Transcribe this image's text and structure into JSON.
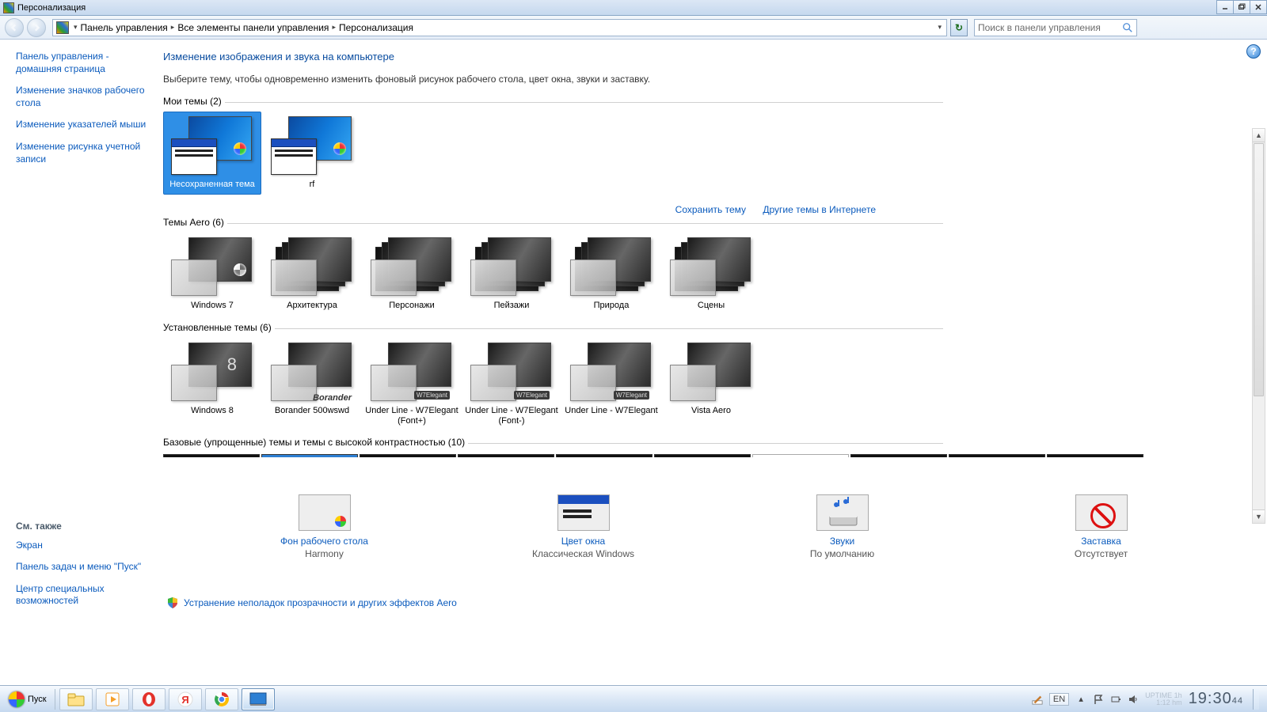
{
  "window": {
    "title": "Персонализация"
  },
  "win_btns": {
    "min": "_",
    "max": "❐",
    "close": "✕"
  },
  "breadcrumb": {
    "segments": [
      "Панель управления",
      "Все элементы панели управления",
      "Персонализация"
    ]
  },
  "search": {
    "placeholder": "Поиск в панели управления"
  },
  "help_btn": "?",
  "sidebar": {
    "links": [
      "Панель управления - домашняя страница",
      "Изменение значков рабочего стола",
      "Изменение указателей мыши",
      "Изменение рисунка учетной записи"
    ]
  },
  "see_also": {
    "heading": "См. также",
    "links": [
      "Экран",
      "Панель задач и меню \"Пуск\"",
      "Центр специальных возможностей"
    ]
  },
  "page": {
    "heading": "Изменение изображения и звука на компьютере",
    "desc": "Выберите тему, чтобы одновременно изменить фоновый рисунок рабочего стола, цвет окна, звуки и заставку."
  },
  "groups": {
    "my": {
      "title": "Мои темы (2)",
      "items": [
        {
          "label": "Несохраненная тема",
          "selected": true
        },
        {
          "label": "rf"
        }
      ],
      "links": {
        "save": "Сохранить тему",
        "more": "Другие темы в Интернете"
      }
    },
    "aero": {
      "title": "Темы Aero (6)",
      "items": [
        {
          "label": "Windows 7"
        },
        {
          "label": "Архитектура"
        },
        {
          "label": "Персонажи"
        },
        {
          "label": "Пейзажи"
        },
        {
          "label": "Природа"
        },
        {
          "label": "Сцены"
        }
      ]
    },
    "installed": {
      "title": "Установленные темы (6)",
      "items": [
        {
          "label": "Windows 8"
        },
        {
          "label": "Borander 500wswd",
          "overlay": "Borander"
        },
        {
          "label": "Under Line - W7Elegant (Font+)",
          "badge": "W7Elegant"
        },
        {
          "label": "Under Line - W7Elegant (Font-)",
          "badge": "W7Elegant"
        },
        {
          "label": "Under Line - W7Elegant",
          "badge": "W7Elegant"
        },
        {
          "label": "Vista Aero"
        }
      ]
    },
    "basic": {
      "title": "Базовые (упрощенные) темы и темы с высокой контрастностью (10)"
    }
  },
  "bottom": {
    "bg": {
      "label": "Фон рабочего стола",
      "value": "Harmony"
    },
    "color": {
      "label": "Цвет окна",
      "value": "Классическая Windows"
    },
    "sound": {
      "label": "Звуки",
      "value": "По умолчанию"
    },
    "saver": {
      "label": "Заставка",
      "value": "Отсутствует"
    }
  },
  "aero_troubleshoot": "Устранение неполадок прозрачности и других эффектов Aero",
  "taskbar": {
    "start": "Пуск",
    "lang": "EN",
    "clock": "19:30",
    "clock_sec": "44"
  }
}
